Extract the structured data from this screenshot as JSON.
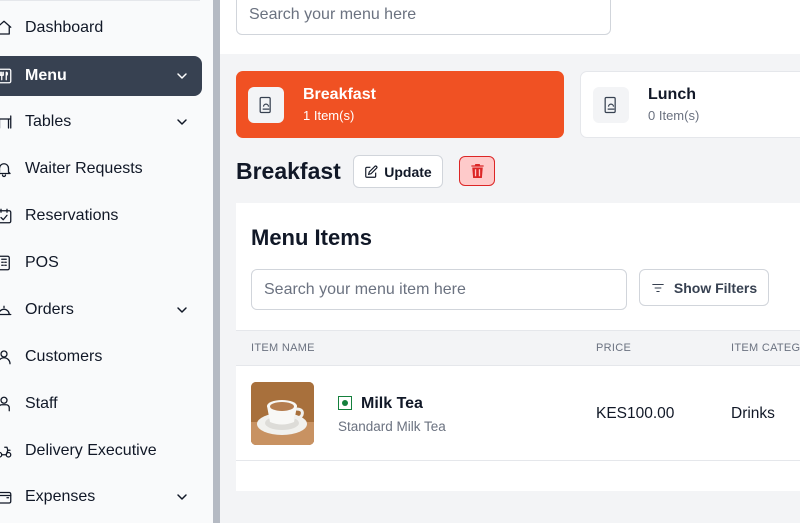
{
  "sidebar": {
    "items": [
      {
        "label": "Dashboard",
        "icon": "home-icon",
        "chevron": false,
        "active": false
      },
      {
        "label": "Menu",
        "icon": "utensils-icon",
        "chevron": true,
        "active": true
      },
      {
        "label": "Tables",
        "icon": "table-icon",
        "chevron": true,
        "active": false
      },
      {
        "label": "Waiter Requests",
        "icon": "bell-icon",
        "chevron": false,
        "active": false
      },
      {
        "label": "Reservations",
        "icon": "calendar-check-icon",
        "chevron": false,
        "active": false
      },
      {
        "label": "POS",
        "icon": "pos-icon",
        "chevron": false,
        "active": false
      },
      {
        "label": "Orders",
        "icon": "cloche-icon",
        "chevron": true,
        "active": false
      },
      {
        "label": "Customers",
        "icon": "user-icon",
        "chevron": false,
        "active": false
      },
      {
        "label": "Staff",
        "icon": "staff-icon",
        "chevron": false,
        "active": false
      },
      {
        "label": "Delivery Executive",
        "icon": "scooter-icon",
        "chevron": false,
        "active": false
      },
      {
        "label": "Expenses",
        "icon": "wallet-icon",
        "chevron": true,
        "active": false
      }
    ]
  },
  "header": {
    "search_placeholder": "Search your menu here"
  },
  "menus": [
    {
      "name": "Breakfast",
      "count": "1 Item(s)",
      "active": true
    },
    {
      "name": "Lunch",
      "count": "0 Item(s)",
      "active": false
    }
  ],
  "selected_menu": {
    "title": "Breakfast",
    "update_label": "Update"
  },
  "items_panel": {
    "title": "Menu Items",
    "search_placeholder": "Search your menu item here",
    "filter_label": "Show Filters",
    "columns": [
      "ITEM NAME",
      "PRICE",
      "ITEM CATEG"
    ],
    "rows": [
      {
        "name": "Milk Tea",
        "description": "Standard Milk Tea",
        "price": "KES100.00",
        "category": "Drinks",
        "type": "veg"
      }
    ]
  },
  "colors": {
    "accent": "#f05123",
    "sidebar_active": "#374151",
    "danger": "#dc2626",
    "veg": "#15803d"
  }
}
